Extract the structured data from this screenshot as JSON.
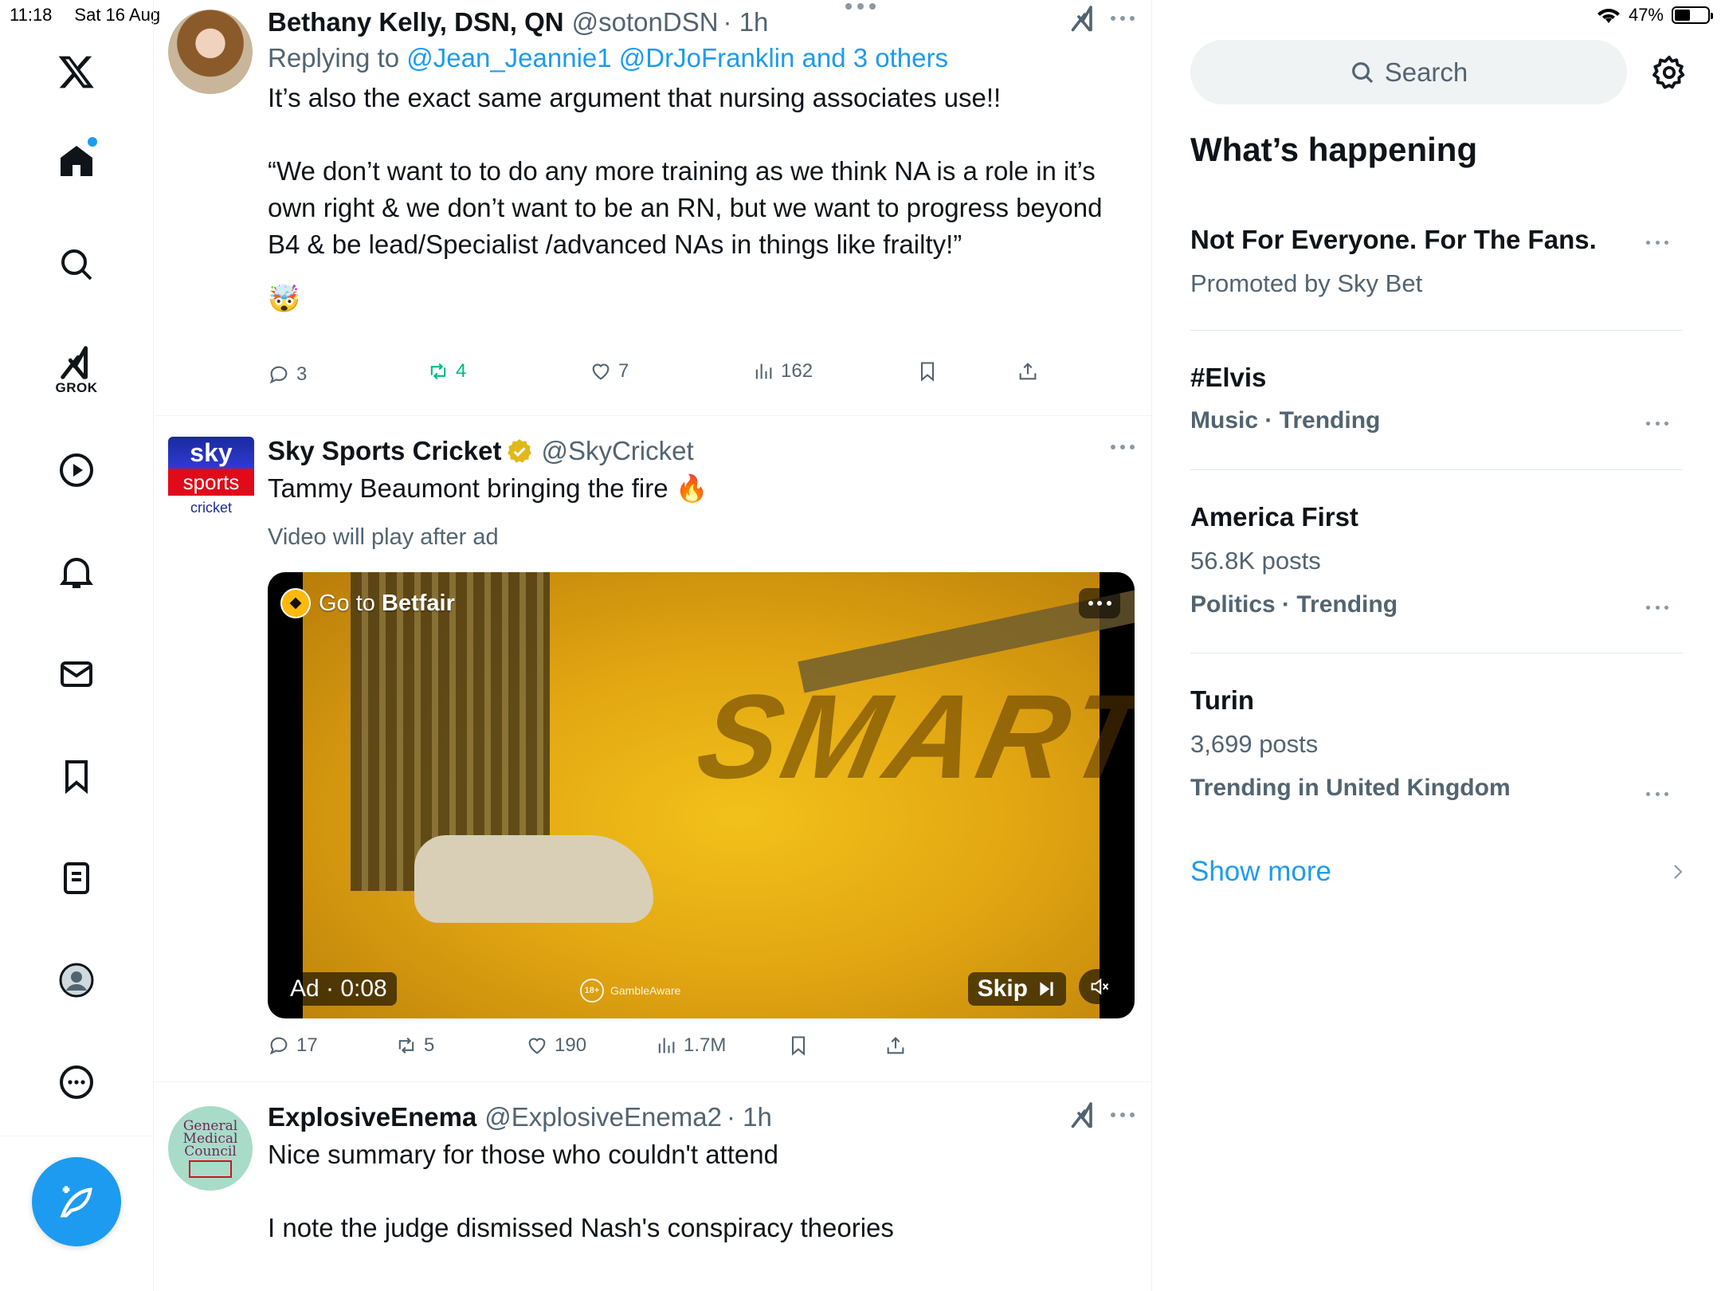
{
  "status": {
    "time": "11:18",
    "date": "Sat 16 Aug",
    "battery": "47%",
    "battery_level": 0.47
  },
  "nav": {
    "items": [
      "x-logo",
      "home",
      "search",
      "grok",
      "video",
      "notifications",
      "messages",
      "bookmarks",
      "lists",
      "profile",
      "more"
    ],
    "grok_label": "GROK"
  },
  "tweets": [
    {
      "name": "Bethany Kelly, DSN, QN",
      "handle": "@sotonDSN",
      "time": "· 1h",
      "reply_prefix": "Replying to ",
      "reply_targets": "@Jean_Jeannie1 @DrJoFranklin and 3 others",
      "text": "It’s also the exact same argument that nursing associates use!!\n\n“We don’t want to to do any more training as we think NA is a role in it’s own right & we don’t want to be an RN, but we want to progress beyond B4 & be lead/Specialist /advanced NAs in things like frailty!”",
      "emoji": "🤯",
      "replies": "3",
      "reposts": "4",
      "likes": "7",
      "views": "162"
    },
    {
      "name": "Sky Sports Cricket",
      "handle": "@SkyCricket",
      "text": "Tammy Beaumont bringing the fire",
      "emoji": "🔥",
      "video_note": "Video will play after ad",
      "avatar_line1": "sky",
      "avatar_line2": "sports",
      "avatar_line3": "cricket",
      "ad": {
        "go_to": "Go to ",
        "brand": "Betfair",
        "overlay_text": "SMART",
        "label": "Ad · 0:08",
        "skip": "Skip",
        "gamble_badge": "18+",
        "gamble_text": "GambleAware"
      },
      "replies": "17",
      "reposts": "5",
      "likes": "190",
      "views": "1.7M"
    },
    {
      "name": "ExplosiveEnema",
      "handle": "@ExplosiveEnema2",
      "time": "· 1h",
      "text": "Nice summary for those who couldn't attend\n\nI note the judge dismissed Nash's conspiracy theories",
      "avatar_line1": "General",
      "avatar_line2": "Medical",
      "avatar_line3": "Council"
    }
  ],
  "sidebar": {
    "search_placeholder": "Search",
    "title": "What’s happening",
    "trends": [
      {
        "title": "Not For Everyone. For The Fans.",
        "sub": "Promoted by Sky Bet"
      },
      {
        "title": "#Elvis",
        "meta": "Music · Trending"
      },
      {
        "title": "America First",
        "count": "56.8K posts",
        "meta": "Politics · Trending"
      },
      {
        "title": "Turin",
        "count": "3,699 posts",
        "meta": "Trending in United Kingdom"
      }
    ],
    "show_more": "Show more"
  },
  "colors": {
    "accent": "#1d9bf0",
    "repost_green": "#00ba7c",
    "text_secondary": "#536471"
  }
}
